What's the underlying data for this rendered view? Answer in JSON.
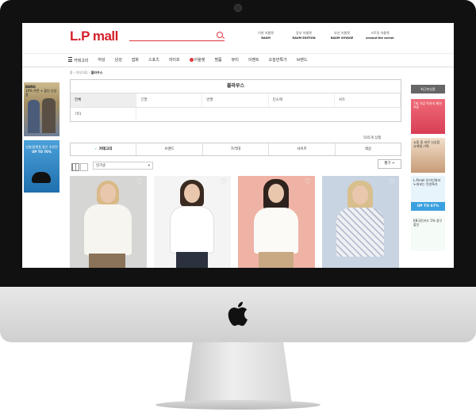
{
  "site": {
    "logo": "L.P mall",
    "search_placeholder": "",
    "outlets": [
      {
        "label": "이천 아울렛",
        "sub": "RAUM"
      },
      {
        "label": "동부 아울렛",
        "sub": "RAUM EDITION"
      },
      {
        "label": "부산 아울렛",
        "sub": "RAUM VOYAGE"
      },
      {
        "label": "스트릿 아울렛",
        "sub": "around the corner"
      }
    ]
  },
  "nav": {
    "items": [
      "카테고리",
      "여성",
      "남성",
      "잡화",
      "스포츠",
      "라이프",
      "아울렛",
      "명품",
      "뷰티",
      "이벤트",
      "오늘만특가",
      "브랜드"
    ]
  },
  "left_banners": [
    {
      "title": "BANG",
      "text": "10% 쿠폰 + 할인 신상품"
    },
    {
      "title": "신발/플랫폼 할인 추천전",
      "text": "UP TO 70%"
    }
  ],
  "right_banners": {
    "header": "최근본상품",
    "items": [
      {
        "text": "7세 기념 럭셔리 패션 쿠폰"
      },
      {
        "text": "쇼핑 중 바로 신상품 사계절 기획"
      },
      {
        "text": "L.Pmall 온라인최저 누워보는 린넨특가",
        "badge": "UP TO 67%"
      },
      {
        "text": "KB국민카드 5% 청구할인"
      }
    ]
  },
  "breadcrumb": [
    "홈",
    "여성의류",
    "블라우스"
  ],
  "filter": {
    "title": "블라우스",
    "cells": [
      [
        "전체",
        "긴팔",
        "반팔",
        "민소매",
        "셔츠"
      ],
      [
        "기타"
      ]
    ]
  },
  "product_count": "505개 상품",
  "tabs": [
    "카테고리",
    "브랜드",
    "가격대",
    "사이즈",
    "색상"
  ],
  "sort": {
    "selected": "인기순"
  },
  "more_label": "펼기 +",
  "products": [
    {
      "image": "model in white ruffle blouse",
      "bg": "#d6d6d4",
      "heart_icon": "heart-outline-icon"
    },
    {
      "image": "model in white button blouse",
      "bg": "#f4f4f4",
      "heart_icon": "heart-outline-icon"
    },
    {
      "image": "model in white blouse with brooch",
      "bg": "#efb3a6",
      "heart_icon": "heart-outline-icon"
    },
    {
      "image": "model in sheer floral blouse",
      "bg": "#c9d4e2",
      "heart_icon": "heart-outline-icon"
    }
  ],
  "colors": {
    "brand": "#d4202a",
    "accent": "#e0353c"
  }
}
